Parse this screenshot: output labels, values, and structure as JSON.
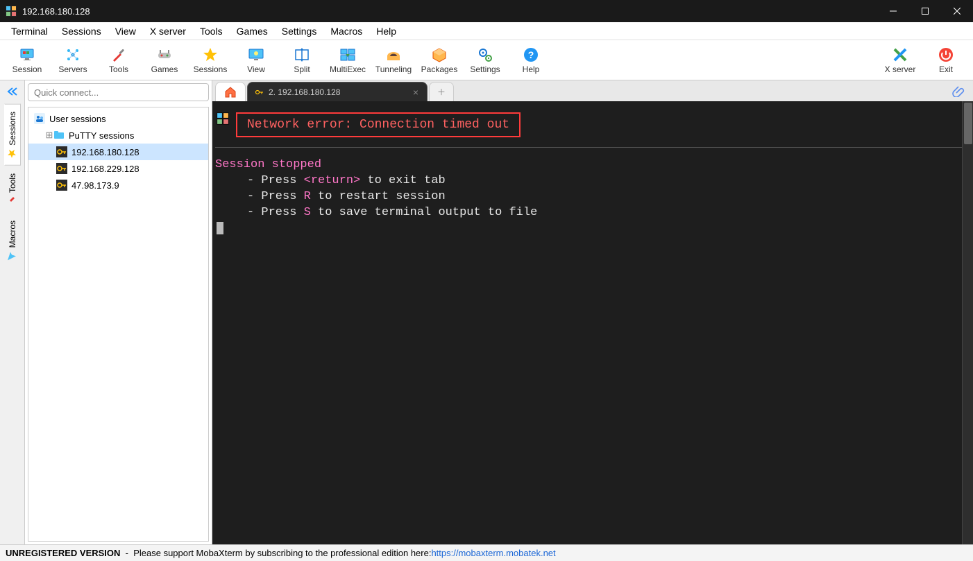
{
  "window": {
    "title": "192.168.180.128"
  },
  "menu": [
    "Terminal",
    "Sessions",
    "View",
    "X server",
    "Tools",
    "Games",
    "Settings",
    "Macros",
    "Help"
  ],
  "toolbar": {
    "left": [
      {
        "name": "session",
        "label": "Session"
      },
      {
        "name": "servers",
        "label": "Servers"
      },
      {
        "name": "tools",
        "label": "Tools"
      },
      {
        "name": "games",
        "label": "Games"
      },
      {
        "name": "sessions",
        "label": "Sessions"
      },
      {
        "name": "view",
        "label": "View"
      },
      {
        "name": "split",
        "label": "Split"
      },
      {
        "name": "multiexec",
        "label": "MultiExec"
      },
      {
        "name": "tunneling",
        "label": "Tunneling"
      },
      {
        "name": "packages",
        "label": "Packages"
      },
      {
        "name": "settings",
        "label": "Settings"
      },
      {
        "name": "help",
        "label": "Help"
      }
    ],
    "right": [
      {
        "name": "xserver",
        "label": "X server"
      },
      {
        "name": "exit",
        "label": "Exit"
      }
    ]
  },
  "quick_connect": {
    "placeholder": "Quick connect..."
  },
  "side_tabs": [
    {
      "name": "sessions",
      "label": "Sessions",
      "active": true,
      "icon": "star"
    },
    {
      "name": "tools",
      "label": "Tools",
      "active": false,
      "icon": "wrench"
    },
    {
      "name": "macros",
      "label": "Macros",
      "active": false,
      "icon": "paperplane"
    }
  ],
  "tree": {
    "root": "User sessions",
    "putty": "PuTTY sessions",
    "items": [
      {
        "label": "192.168.180.128",
        "selected": true
      },
      {
        "label": "192.168.229.128",
        "selected": false
      },
      {
        "label": "47.98.173.9",
        "selected": false
      }
    ]
  },
  "tabs": {
    "active_label": "2. 192.168.180.128"
  },
  "terminal": {
    "error": "Network error: Connection timed out",
    "stopped": "Session stopped",
    "line1_a": "- Press ",
    "line1_key": "<return>",
    "line1_b": " to exit tab",
    "line2_a": "- Press ",
    "line2_key": "R",
    "line2_b": " to restart session",
    "line3_a": "- Press ",
    "line3_key": "S",
    "line3_b": " to save terminal output to file"
  },
  "status": {
    "prefix": "UNREGISTERED VERSION",
    "sep": "  -  ",
    "text": "Please support MobaXterm by subscribing to the professional edition here:  ",
    "link": "https://mobaxterm.mobatek.net"
  }
}
